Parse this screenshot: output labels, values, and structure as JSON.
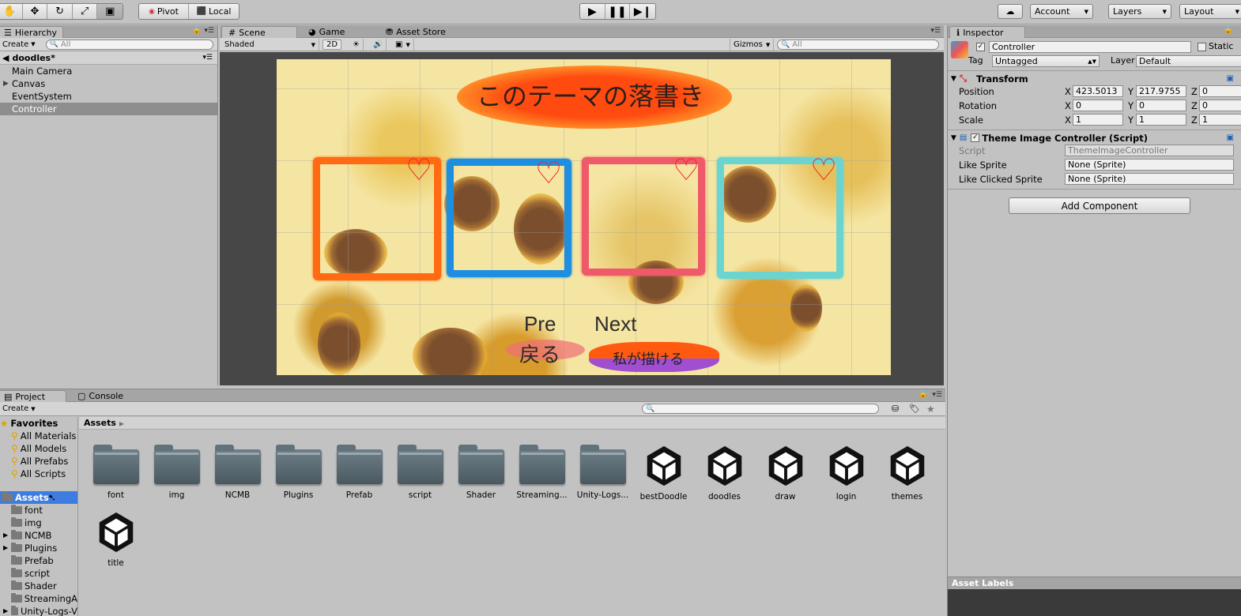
{
  "toolbar": {
    "pivot_label": "Pivot",
    "local_label": "Local",
    "account_label": "Account",
    "layers_label": "Layers",
    "layout_label": "Layout"
  },
  "hierarchy": {
    "tab_label": "Hierarchy",
    "create_label": "Create",
    "search_placeholder": "All",
    "scene_name": "doodles*",
    "items": [
      {
        "label": "Main Camera",
        "expandable": false,
        "selected": false
      },
      {
        "label": "Canvas",
        "expandable": true,
        "selected": false
      },
      {
        "label": "EventSystem",
        "expandable": false,
        "selected": false
      },
      {
        "label": "Controller",
        "expandable": false,
        "selected": true
      }
    ]
  },
  "scene": {
    "tabs": [
      {
        "label": "Scene",
        "icon": "grid-icon"
      },
      {
        "label": "Game",
        "icon": "pacman-icon"
      },
      {
        "label": "Asset Store",
        "icon": "bag-icon"
      }
    ],
    "shading_mode": "Shaded",
    "mode_2d": "2D",
    "gizmos_label": "Gizmos",
    "search_placeholder": "All",
    "canvas": {
      "title": "このテーマの落書き",
      "pre_label": "Pre",
      "next_label": "Next",
      "back_label": "戻る",
      "draw_label": "私が描ける",
      "frame_colors": [
        "#ff6a12",
        "#1e8fe0",
        "#ef5a6a",
        "#6cd4d0"
      ]
    }
  },
  "inspector": {
    "tab_label": "Inspector",
    "object_name": "Controller",
    "static_label": "Static",
    "tag_label": "Tag",
    "tag_value": "Untagged",
    "layer_label": "Layer",
    "layer_value": "Default",
    "transform": {
      "title": "Transform",
      "position_label": "Position",
      "rotation_label": "Rotation",
      "scale_label": "Scale",
      "x_axis": "X",
      "y_axis": "Y",
      "z_axis": "Z",
      "position": {
        "x": "423.5013",
        "y": "217.9755",
        "z": "0"
      },
      "rotation": {
        "x": "0",
        "y": "0",
        "z": "0"
      },
      "scale": {
        "x": "1",
        "y": "1",
        "z": "1"
      }
    },
    "script_component": {
      "title": "Theme Image Controller (Script)",
      "script_label": "Script",
      "script_value": "ThemeImageController",
      "like_sprite_label": "Like Sprite",
      "like_sprite_value": "None (Sprite)",
      "like_clicked_label": "Like Clicked Sprite",
      "like_clicked_value": "None (Sprite)"
    },
    "add_component_label": "Add Component",
    "asset_labels_title": "Asset Labels"
  },
  "project": {
    "tabs": [
      {
        "label": "Project",
        "icon": "folder-icon"
      },
      {
        "label": "Console",
        "icon": "console-icon"
      }
    ],
    "create_label": "Create",
    "favorites_label": "Favorites",
    "favorites": [
      "All Materials",
      "All Models",
      "All Prefabs",
      "All Scripts"
    ],
    "assets_root": "Assets",
    "tree": [
      {
        "label": "font",
        "expandable": false
      },
      {
        "label": "img",
        "expandable": false
      },
      {
        "label": "NCMB",
        "expandable": true
      },
      {
        "label": "Plugins",
        "expandable": true
      },
      {
        "label": "Prefab",
        "expandable": false
      },
      {
        "label": "script",
        "expandable": false
      },
      {
        "label": "Shader",
        "expandable": false
      },
      {
        "label": "StreamingA",
        "expandable": false
      },
      {
        "label": "Unity-Logs-V",
        "expandable": true
      }
    ],
    "breadcrumb": "Assets",
    "items": [
      {
        "label": "font",
        "kind": "folder"
      },
      {
        "label": "img",
        "kind": "folder"
      },
      {
        "label": "NCMB",
        "kind": "folder"
      },
      {
        "label": "Plugins",
        "kind": "folder"
      },
      {
        "label": "Prefab",
        "kind": "folder"
      },
      {
        "label": "script",
        "kind": "folder"
      },
      {
        "label": "Shader",
        "kind": "folder"
      },
      {
        "label": "Streaming...",
        "kind": "folder"
      },
      {
        "label": "Unity-Logs...",
        "kind": "folder"
      },
      {
        "label": "bestDoodle",
        "kind": "scene"
      },
      {
        "label": "doodles",
        "kind": "scene"
      },
      {
        "label": "draw",
        "kind": "scene"
      },
      {
        "label": "login",
        "kind": "scene"
      },
      {
        "label": "themes",
        "kind": "scene"
      },
      {
        "label": "title",
        "kind": "scene"
      }
    ]
  }
}
